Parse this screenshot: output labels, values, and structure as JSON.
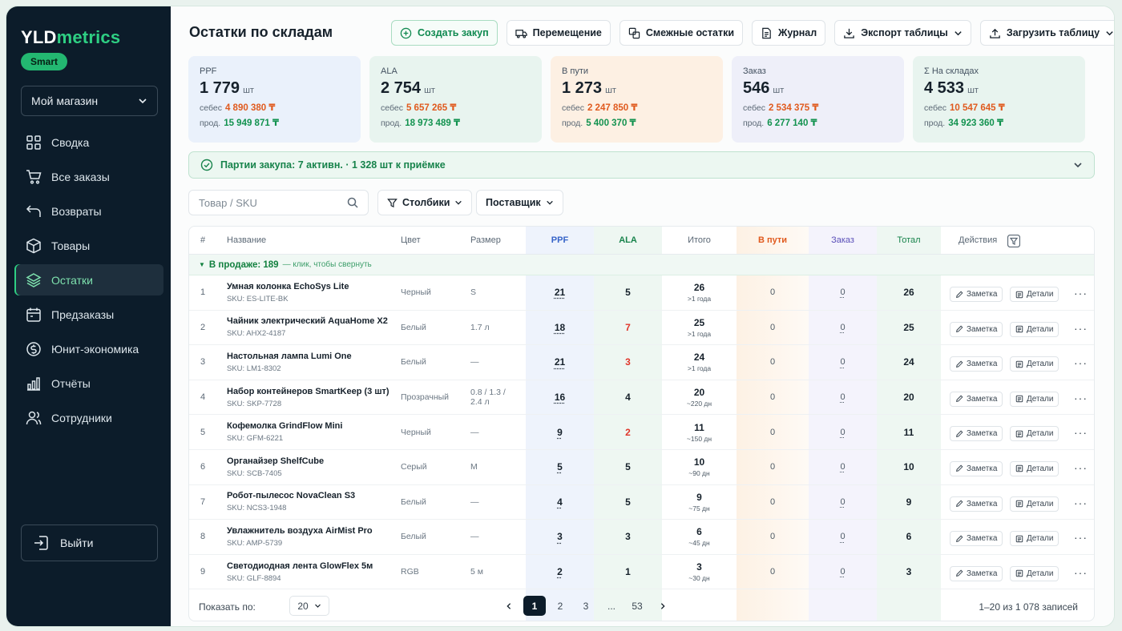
{
  "brand": {
    "part1": "YLD",
    "part2": "metrics",
    "plan": "Smart"
  },
  "store_select": {
    "value": "Мой магазин"
  },
  "nav": [
    {
      "label": "Сводка",
      "icon": "grid-icon"
    },
    {
      "label": "Все заказы",
      "icon": "cart-icon"
    },
    {
      "label": "Возвраты",
      "icon": "return-icon"
    },
    {
      "label": "Товары",
      "icon": "box-icon"
    },
    {
      "label": "Остатки",
      "icon": "layers-icon",
      "active": true
    },
    {
      "label": "Предзаказы",
      "icon": "calendar-icon"
    },
    {
      "label": "Юнит-экономика",
      "icon": "coin-icon"
    },
    {
      "label": "Отчёты",
      "icon": "bar-chart-icon"
    },
    {
      "label": "Сотрудники",
      "icon": "users-icon"
    }
  ],
  "logout_label": "Выйти",
  "page_title": "Остатки по складам",
  "toolbar": {
    "create_purchase": "Создать закуп",
    "transfer": "Перемещение",
    "related_stock": "Смежные остатки",
    "journal": "Журнал",
    "export": "Экспорт таблицы",
    "import": "Загрузить таблицу"
  },
  "kpis": [
    {
      "label": "PPF",
      "value": "1 779",
      "unit": "шт",
      "cost_label": "себес",
      "cost": "4 890 380 ₸",
      "sale_label": "прод.",
      "sale": "15 949 871 ₸"
    },
    {
      "label": "ALA",
      "value": "2 754",
      "unit": "шт",
      "cost_label": "себес",
      "cost": "5 657 265 ₸",
      "sale_label": "прод.",
      "sale": "18 973 489 ₸"
    },
    {
      "label": "В пути",
      "value": "1 273",
      "unit": "шт",
      "cost_label": "себес",
      "cost": "2 247 850 ₸",
      "sale_label": "прод.",
      "sale": "5 400 370 ₸"
    },
    {
      "label": "Заказ",
      "value": "546",
      "unit": "шт",
      "cost_label": "себес",
      "cost": "2 534 375 ₸",
      "sale_label": "прод.",
      "sale": "6 277 140 ₸"
    },
    {
      "label": "Σ На складах",
      "value": "4 533",
      "unit": "шт",
      "cost_label": "себес",
      "cost": "10 547 645 ₸",
      "sale_label": "прод.",
      "sale": "34 923 360 ₸"
    }
  ],
  "batches_text": "Партии закупа: 7 активн. · 1 328 шт к приёмке",
  "filters": {
    "search_placeholder": "Товар / SKU",
    "columns": "Столбики",
    "supplier": "Поставщик"
  },
  "columns": {
    "num": "#",
    "name": "Название",
    "color": "Цвет",
    "size": "Размер",
    "ppf": "PPF",
    "ala": "ALA",
    "total_sum": "Итого",
    "in_transit": "В пути",
    "order": "Заказ",
    "total": "Тотал",
    "actions": "Действия"
  },
  "group": {
    "label": "В продаже: 189",
    "hint": "— клик, чтобы свернуть"
  },
  "row_actions": {
    "note": "Заметка",
    "details": "Детали"
  },
  "rows": [
    {
      "n": "1",
      "name": "Умная колонка EchoSys Lite",
      "sku": "SKU: ES-LITE-BK",
      "color": "Черный",
      "size": "S",
      "ppf": "21",
      "ala": "5",
      "sum": "26",
      "age": ">1 года",
      "transit": "0",
      "order": "0",
      "total": "26"
    },
    {
      "n": "2",
      "name": "Чайник электрический AquaHome X2",
      "sku": "SKU: AHX2-4187",
      "color": "Белый",
      "size": "1.7 л",
      "ppf": "18",
      "ala": "7",
      "sum": "25",
      "age": ">1 года",
      "transit": "0",
      "order": "0",
      "total": "25"
    },
    {
      "n": "3",
      "name": "Настольная лампа Lumi One",
      "sku": "SKU: LM1-8302",
      "color": "Белый",
      "size": "—",
      "ppf": "21",
      "ala": "3",
      "sum": "24",
      "age": ">1 года",
      "transit": "0",
      "order": "0",
      "total": "24"
    },
    {
      "n": "4",
      "name": "Набор контейнеров SmartKeep (3 шт)",
      "sku": "SKU: SKP-7728",
      "color": "Прозрачный",
      "size": "0.8 / 1.3 / 2.4 л",
      "ppf": "16",
      "ala": "4",
      "sum": "20",
      "age": "~220 дн",
      "transit": "0",
      "order": "0",
      "total": "20"
    },
    {
      "n": "5",
      "name": "Кофемолка GrindFlow Mini",
      "sku": "SKU: GFM-6221",
      "color": "Черный",
      "size": "—",
      "ppf": "9",
      "ala": "2",
      "sum": "11",
      "age": "~150 дн",
      "transit": "0",
      "order": "0",
      "total": "11"
    },
    {
      "n": "6",
      "name": "Органайзер ShelfCube",
      "sku": "SKU: SCB-7405",
      "color": "Серый",
      "size": "M",
      "ppf": "5",
      "ala": "5",
      "sum": "10",
      "age": "~90 дн",
      "transit": "0",
      "order": "0",
      "total": "10"
    },
    {
      "n": "7",
      "name": "Робот-пылесос NovaClean S3",
      "sku": "SKU: NCS3-1948",
      "color": "Белый",
      "size": "—",
      "ppf": "4",
      "ala": "5",
      "sum": "9",
      "age": "~75 дн",
      "transit": "0",
      "order": "0",
      "total": "9"
    },
    {
      "n": "8",
      "name": "Увлажнитель воздуха AirMist Pro",
      "sku": "SKU: AMP-5739",
      "color": "Белый",
      "size": "—",
      "ppf": "3",
      "ala": "3",
      "sum": "6",
      "age": "~45 дн",
      "transit": "0",
      "order": "0",
      "total": "6"
    },
    {
      "n": "9",
      "name": "Светодиодная лента GlowFlex 5м",
      "sku": "SKU: GLF-8894",
      "color": "RGB",
      "size": "5 м",
      "ppf": "2",
      "ala": "1",
      "sum": "3",
      "age": "~30 дн",
      "transit": "0",
      "order": "0",
      "total": "3"
    }
  ],
  "footer": {
    "per_page_label": "Показать по:",
    "per_page_value": "20",
    "pages": [
      "1",
      "2",
      "3",
      "...",
      "53"
    ],
    "records": "1–20 из 1 078 записей"
  }
}
